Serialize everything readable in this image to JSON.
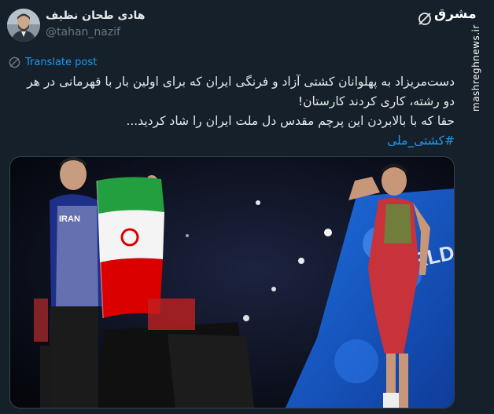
{
  "author": {
    "display_name": "هادی طحان نظیف",
    "handle": "@tahan_nazif"
  },
  "translate_label": "Translate post",
  "post": {
    "line1": "دست‌مریزاد به پهلوانان کشتی آزاد و فرنگی ایران که برای اولین بار با قهرمانی در هر",
    "line2": "دو رشته، کاری کردند کارستان!",
    "line3": "حقا که با بالابردن این پرچم مقدس دل ملت ایران را شاد کردید...",
    "hashtag": "#کشتی_ملی"
  },
  "media": {
    "banner_text": "WORLD CHAMPIONSHIPS",
    "shirt_text": "IRAN"
  },
  "watermark": {
    "logo": "مشرق",
    "site": "mashreghnews.ir"
  },
  "colors": {
    "background": "#15202b",
    "link": "#1d9bf0",
    "text": "#e7e9ea",
    "muted": "#71767b"
  },
  "icons": {
    "grok": "grok-icon",
    "translate": "translate-icon"
  }
}
